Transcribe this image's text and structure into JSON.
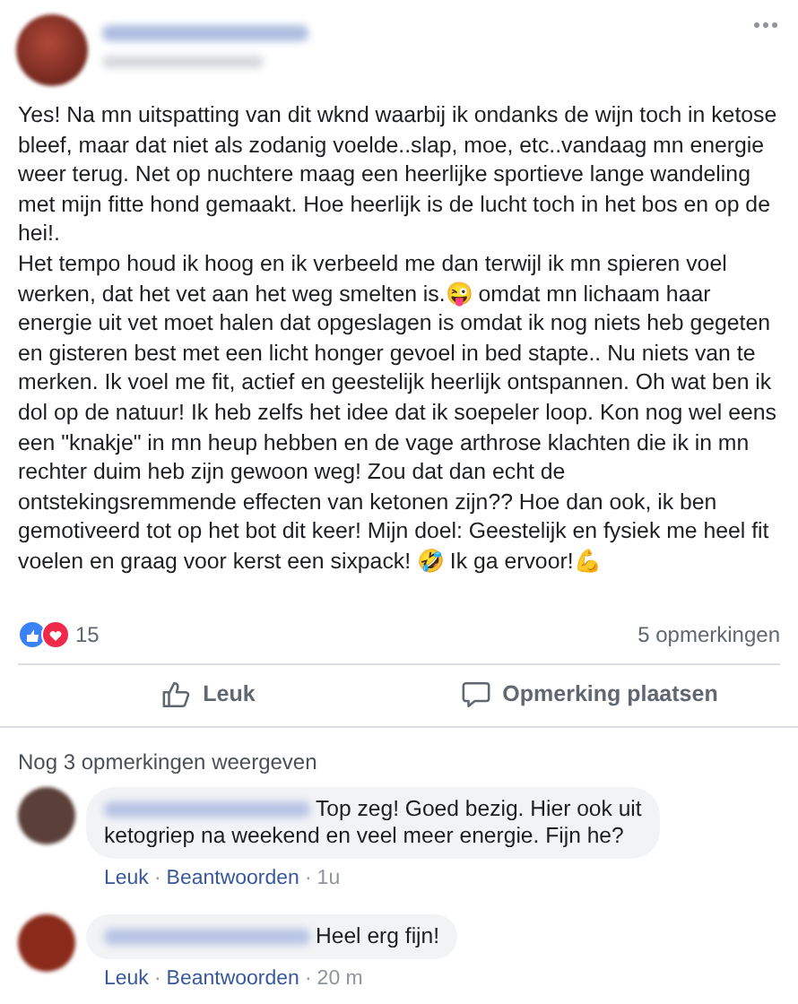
{
  "post": {
    "paragraphs": [
      "Yes! Na mn uitspatting van dit wknd waarbij ik ondanks de wijn toch in ketose bleef, maar dat niet als zodanig voelde..slap, moe, etc..vandaag mn energie weer terug. Net op nuchtere maag een heerlijke sportieve lange wandeling met mijn fitte hond gemaakt. Hoe heerlijk is de lucht toch in het bos en op de hei!.",
      "Het tempo houd ik hoog en ik verbeeld me dan terwijl ik mn spieren voel werken, dat het vet aan het weg smelten is.😜 omdat mn lichaam haar energie uit vet moet halen dat opgeslagen is omdat ik nog niets heb gegeten en gisteren best met een licht honger gevoel in bed stapte.. Nu niets van te merken. Ik voel me fit, actief en geestelijk heerlijk ontspannen. Oh wat ben ik dol op de natuur! Ik heb zelfs het idee dat ik soepeler loop. Kon nog wel eens een \"knakje\" in mn heup hebben en de vage arthrose klachten die ik in mn rechter duim heb zijn gewoon weg! Zou dat dan echt de ontstekingsremmende effecten van ketonen zijn?? Hoe dan ook, ik ben gemotiveerd tot op het bot dit keer! Mijn doel: Geestelijk en fysiek me heel fit voelen en graag voor kerst een sixpack! 🤣 Ik ga ervoor!💪"
    ],
    "reaction_count": "15",
    "comment_count": "5 opmerkingen",
    "actions": [
      {
        "kind": "like",
        "label": "Leuk"
      },
      {
        "kind": "comment",
        "label": "Opmerking plaatsen"
      }
    ]
  },
  "more_comments": "Nog 3 opmerkingen weergeven",
  "comments": [
    {
      "lines": [
        "Top zeg! Goed bezig. Hier ook uit",
        "ketogriep na weekend en veel meer energie. Fijn he?"
      ],
      "meta": [
        {
          "kind": "link",
          "text": "Leuk"
        },
        {
          "kind": "sep",
          "text": "·"
        },
        {
          "kind": "link",
          "text": "Beantwoorden"
        },
        {
          "kind": "sep",
          "text": "·"
        },
        {
          "kind": "time",
          "text": "1u"
        }
      ]
    },
    {
      "lines": [
        "Heel erg fijn!"
      ],
      "meta": [
        {
          "kind": "link",
          "text": "Leuk"
        },
        {
          "kind": "sep",
          "text": "·"
        },
        {
          "kind": "link",
          "text": "Beantwoorden"
        },
        {
          "kind": "sep",
          "text": "·"
        },
        {
          "kind": "time",
          "text": "20 m"
        }
      ]
    }
  ]
}
